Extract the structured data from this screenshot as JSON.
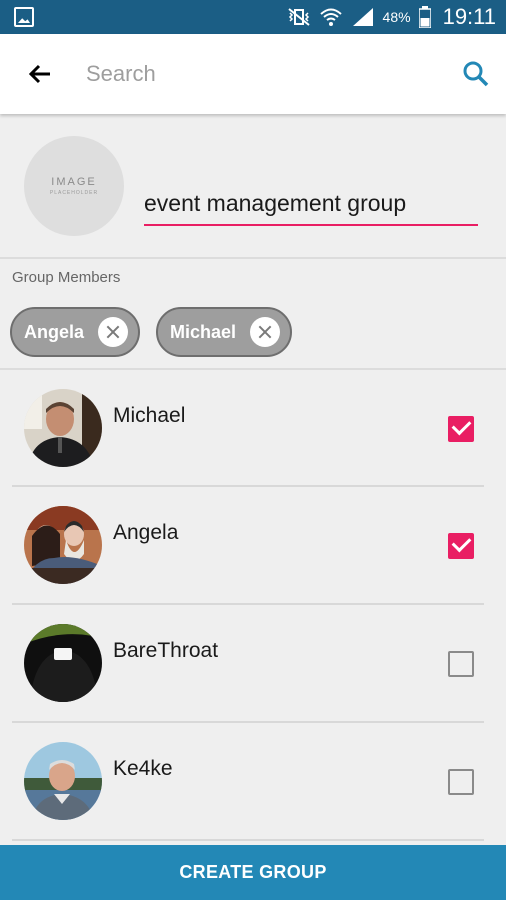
{
  "status_bar": {
    "battery_percent": "48%",
    "time": "19:11"
  },
  "toolbar": {
    "search_placeholder": "Search"
  },
  "group": {
    "image_placeholder": "IMAGE",
    "image_subtext": "PLACEHOLDER",
    "name": "event management group"
  },
  "members": {
    "label": "Group Members",
    "chips": [
      "Angela",
      "Michael"
    ]
  },
  "contacts": [
    {
      "name": "Michael",
      "checked": true
    },
    {
      "name": "Angela",
      "checked": true
    },
    {
      "name": "BareThroat",
      "checked": false
    },
    {
      "name": "Ke4ke",
      "checked": false
    }
  ],
  "colors": {
    "status_bar": "#1b5e85",
    "accent": "#e91e63",
    "primary": "#2388b6"
  },
  "footer": {
    "create_label": "CREATE GROUP"
  }
}
